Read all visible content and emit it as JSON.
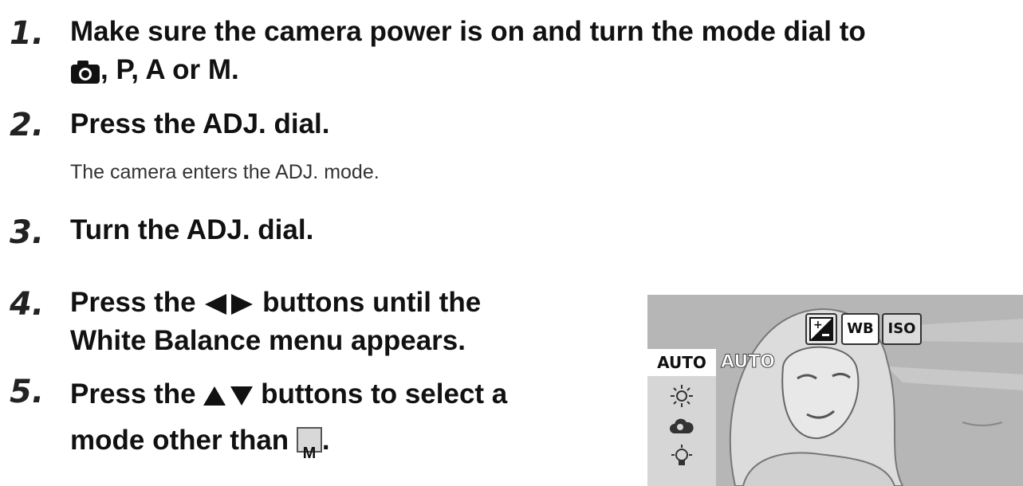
{
  "steps": [
    {
      "num": "1.",
      "line1": "Make sure the camera power is on and turn the mode dial to",
      "line2_suffix": ", P, A or M."
    },
    {
      "num": "2.",
      "text": "Press the ADJ. dial.",
      "note": "The camera enters the ADJ. mode."
    },
    {
      "num": "3.",
      "text": "Turn the ADJ. dial."
    },
    {
      "num": "4.",
      "line1_pre": "Press the",
      "line1_post": "buttons until the",
      "line2": "White Balance menu appears."
    },
    {
      "num": "5.",
      "line1_pre": "Press the",
      "line1_post": "buttons to select a",
      "line2_pre": "mode other than",
      "line2_post": "."
    }
  ],
  "icons": {
    "camera": "camera-icon",
    "left_right": "left-right-arrow-icon",
    "up_down": "up-down-arrow-icon",
    "manual_wb": "manual-wb-icon",
    "manual_wb_letter": "M"
  },
  "screen": {
    "tabs": [
      "WB",
      "ISO"
    ],
    "exposure_tab_icon": "exposure-compensation-icon",
    "menu_selected": "AUTO",
    "overlay_mode": "AUTO",
    "menu_icons": [
      "sun-icon",
      "cloud-icon",
      "tungsten-icon"
    ]
  }
}
